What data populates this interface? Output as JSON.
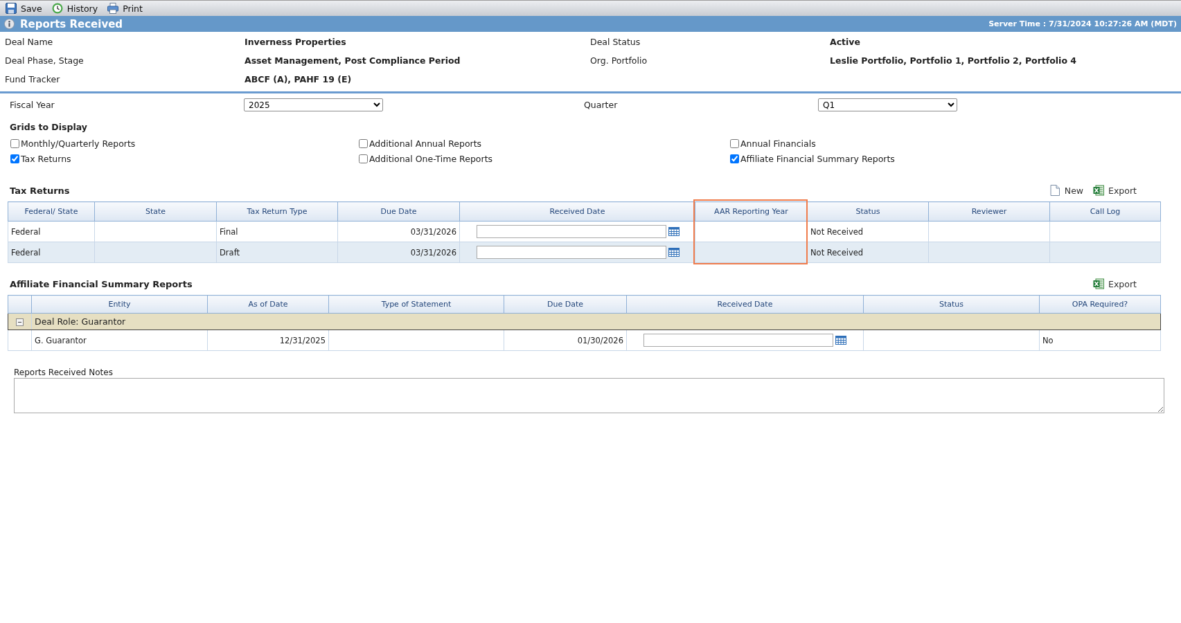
{
  "toolbar": [
    {
      "kind": "save",
      "label": "Save"
    },
    {
      "kind": "history",
      "label": "History"
    },
    {
      "kind": "print",
      "label": "Print"
    }
  ],
  "title_bar": {
    "title": "Reports Received",
    "server_time": "Server Time : 7/31/2024 10:27:26 AM (MDT)"
  },
  "deal_info": [
    {
      "label": "Deal Name",
      "value": "Inverness Properties"
    },
    {
      "label": "Deal Status",
      "value": "Active"
    },
    {
      "label": "Deal Phase, Stage",
      "value": "Asset Management, Post Compliance Period"
    },
    {
      "label": "Org. Portfolio",
      "value": "Leslie Portfolio, Portfolio 1, Portfolio 2, Portfolio 4"
    },
    {
      "label": "Fund Tracker",
      "value": "ABCF (A), PAHF 19 (E)"
    }
  ],
  "filters": [
    {
      "label": "Fiscal Year",
      "value": "2025"
    },
    {
      "label": "Quarter",
      "value": "Q1"
    }
  ],
  "grids_to_display": {
    "title": "Grids to Display",
    "options": [
      {
        "label": "Monthly/Quarterly Reports",
        "checked": false
      },
      {
        "label": "Additional Annual Reports",
        "checked": false
      },
      {
        "label": "Annual Financials",
        "checked": false
      },
      {
        "label": "Tax Returns",
        "checked": true
      },
      {
        "label": "Additional One-Time Reports",
        "checked": false
      },
      {
        "label": "Affiliate Financial Summary Reports",
        "checked": true
      }
    ]
  },
  "tax_returns": {
    "title": "Tax Returns",
    "actions": [
      {
        "kind": "new",
        "label": "New"
      },
      {
        "kind": "export",
        "label": "Export"
      }
    ],
    "columns": [
      {
        "label": "Federal/ State",
        "highlighted": false
      },
      {
        "label": "State",
        "highlighted": false
      },
      {
        "label": "Tax Return Type",
        "highlighted": false
      },
      {
        "label": "Due Date",
        "highlighted": false
      },
      {
        "label": "Received Date",
        "highlighted": false
      },
      {
        "label": "AAR Reporting Year",
        "highlighted": true
      },
      {
        "label": "Status",
        "highlighted": false
      },
      {
        "label": "Reviewer",
        "highlighted": false
      },
      {
        "label": "Call Log",
        "highlighted": false
      }
    ],
    "rows": [
      {
        "federal_state": "Federal",
        "tax_return_type": "Final",
        "due_date": "03/31/2026",
        "status": "Not Received"
      },
      {
        "federal_state": "Federal",
        "tax_return_type": "Draft",
        "due_date": "03/31/2026",
        "status": "Not Received"
      }
    ]
  },
  "affiliate_financial_summary_reports": {
    "title": "Affiliate Financial Summary Reports",
    "actions": [
      {
        "kind": "export",
        "label": "Export"
      }
    ],
    "columns": [
      {
        "label": "Entity"
      },
      {
        "label": "As of Date"
      },
      {
        "label": "Type of Statement"
      },
      {
        "label": "Due Date"
      },
      {
        "label": "Received Date"
      },
      {
        "label": "Status"
      },
      {
        "label": "OPA Required?"
      }
    ],
    "groups": [
      {
        "label": "Deal Role: Guarantor",
        "expanded": true,
        "rows": [
          {
            "entity": "G. Guarantor",
            "as_of_date": "12/31/2025",
            "due_date": "01/30/2026",
            "opa_required": "No"
          }
        ]
      }
    ]
  },
  "notes": {
    "label": "Reports Received Notes"
  }
}
